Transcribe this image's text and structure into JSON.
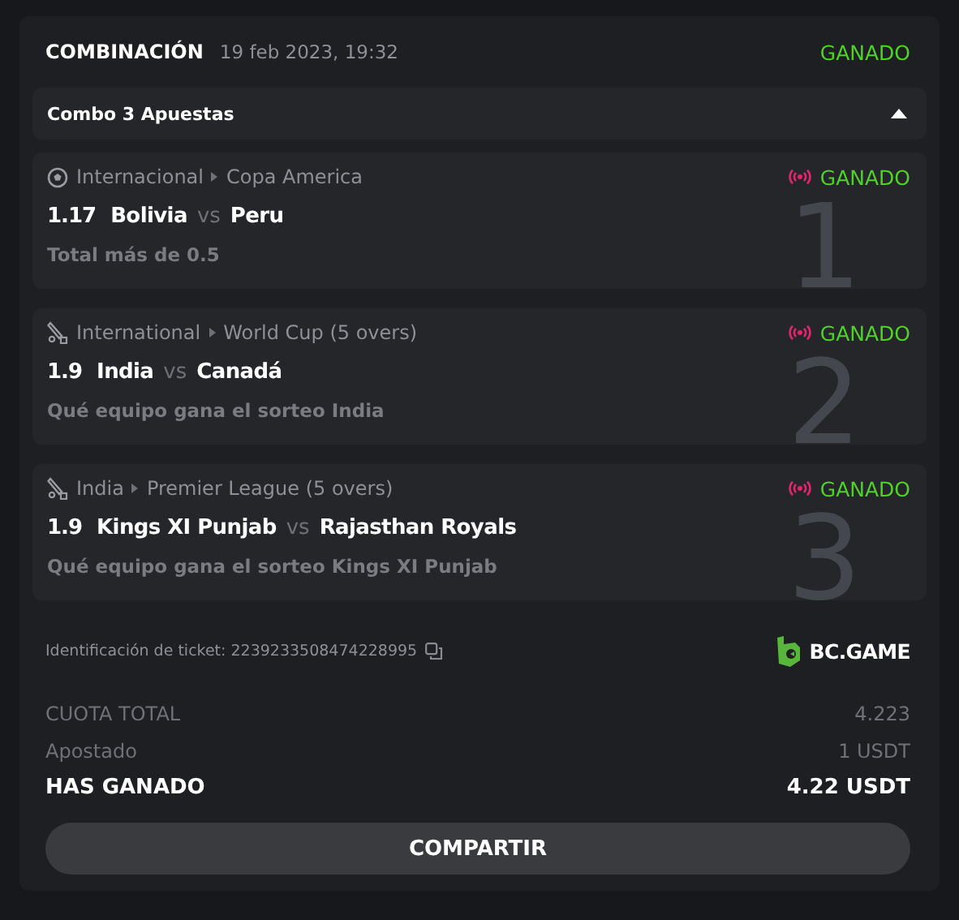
{
  "header": {
    "title": "COMBINACIÓN",
    "date": "19 feb 2023, 19:32",
    "status": "GANADO"
  },
  "combo": {
    "label": "Combo 3 Apuestas",
    "expanded": true
  },
  "bets": [
    {
      "kind": "soccer",
      "category": "Internacional",
      "league": "Copa America",
      "live": true,
      "status": "GANADO",
      "odds": "1.17",
      "home": "Bolivia",
      "vs": "vs",
      "away": "Peru",
      "market": "Total más de 0.5",
      "index": "1"
    },
    {
      "kind": "cricket",
      "category": "International",
      "league": "World Cup (5 overs)",
      "live": true,
      "status": "GANADO",
      "odds": "1.9",
      "home": "India",
      "vs": "vs",
      "away": "Canadá",
      "market": "Qué equipo gana el sorteo India",
      "index": "2"
    },
    {
      "kind": "cricket",
      "category": "India",
      "league": "Premier League (5 overs)",
      "live": true,
      "status": "GANADO",
      "odds": "1.9",
      "home": "Kings XI Punjab",
      "vs": "vs",
      "away": "Rajasthan Royals",
      "market": "Qué equipo gana el sorteo Kings XI Punjab",
      "index": "3"
    }
  ],
  "ticket": {
    "label": "Identificación de ticket: 2239233508474228995",
    "brand": "BC.GAME"
  },
  "totals": [
    {
      "kind": "muted",
      "label": "CUOTA TOTAL",
      "value": "4.223"
    },
    {
      "kind": "muted",
      "label": "Apostado",
      "value": "1 USDT"
    },
    {
      "kind": "strong",
      "label": "HAS GANADO",
      "value": "4.22 USDT"
    }
  ],
  "share_button": "COMPARTIR"
}
